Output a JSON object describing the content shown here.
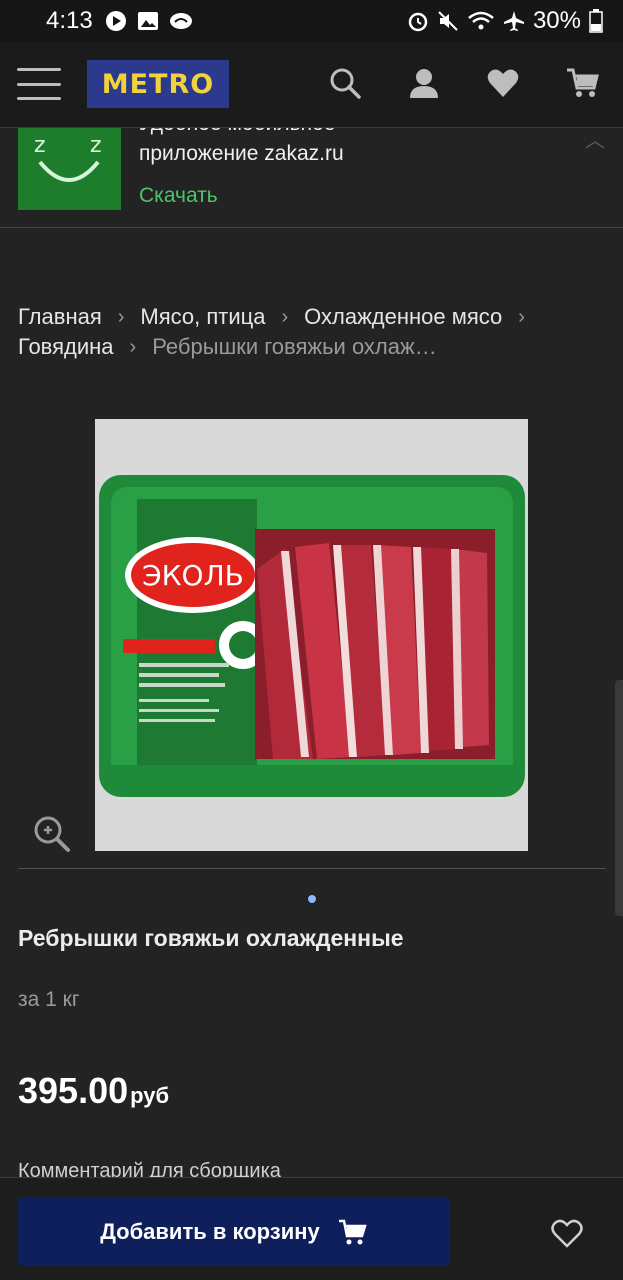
{
  "status_bar": {
    "time": "4:13",
    "battery": "30%"
  },
  "header": {
    "logo_text": "METRO"
  },
  "promo": {
    "line1": "Удобное мобильное",
    "line2": "приложение zakaz.ru",
    "download": "Скачать"
  },
  "breadcrumb": {
    "items": [
      "Главная",
      "Мясо, птица",
      "Охлажденное мясо",
      "Говядина"
    ],
    "current": "Ребрышки говяжьи охлаж…"
  },
  "product": {
    "brand_on_image": "ЭКОЛЬ",
    "title": "Ребрышки говяжьи охлажденные",
    "unit": "за 1 кг",
    "price": "395.00",
    "currency": "руб",
    "comment_label": "Комментарий для сборщика"
  },
  "actions": {
    "add_to_cart": "Добавить в корзину"
  },
  "colors": {
    "accent_green": "#4bc46a",
    "button_blue": "#0f1f5c",
    "logo_yellow": "#f2d23c"
  }
}
